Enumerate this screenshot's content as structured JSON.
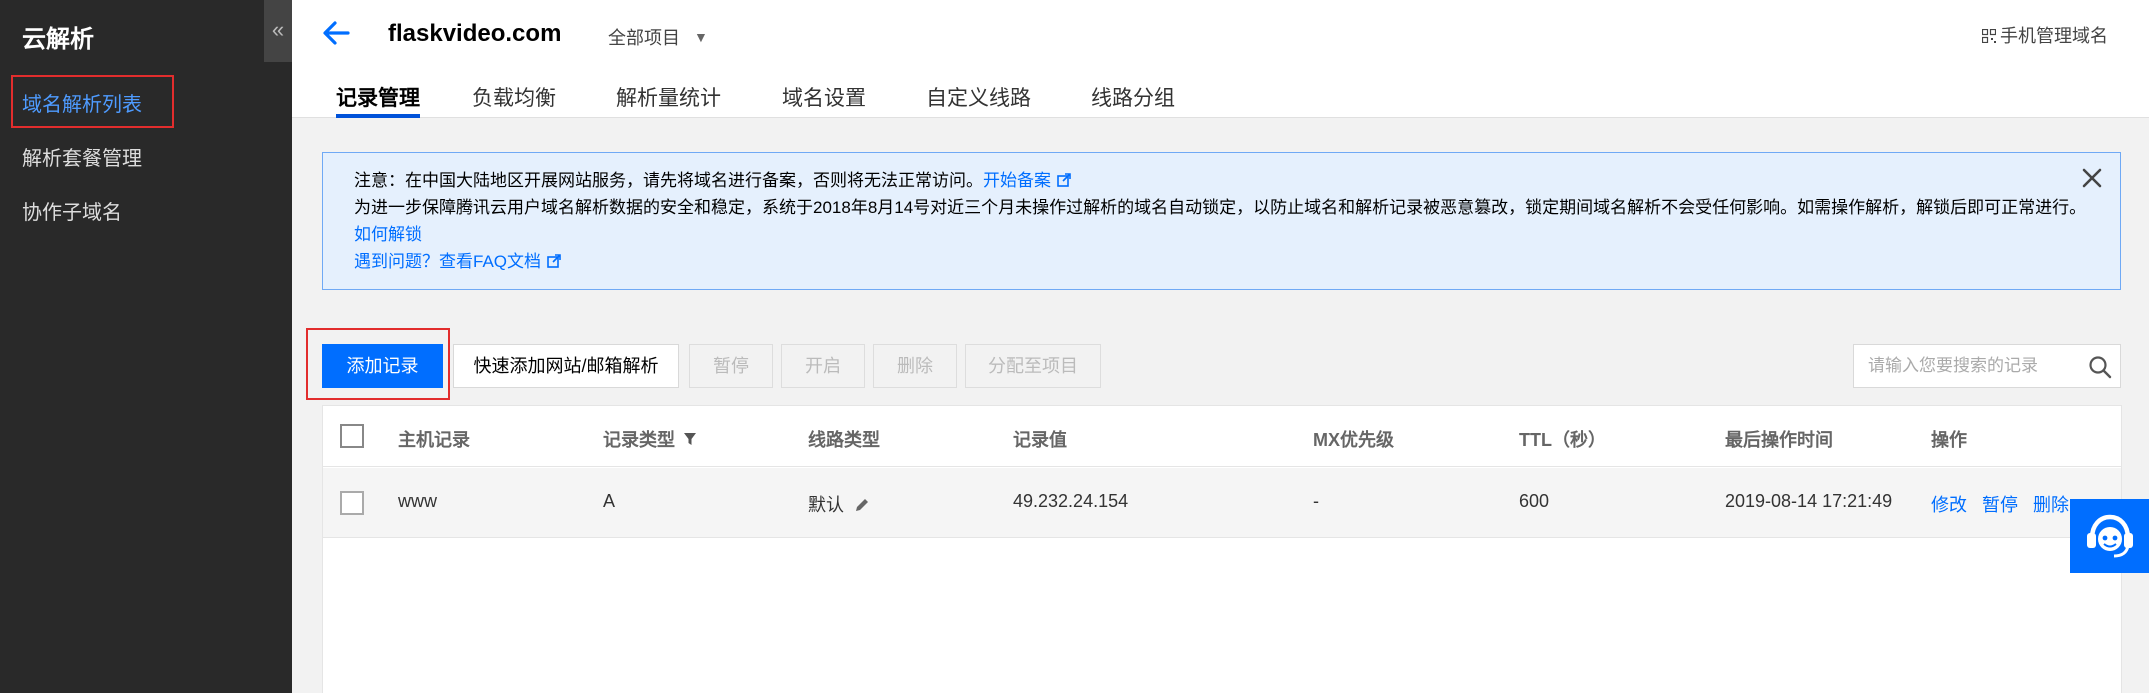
{
  "sidebar": {
    "brand": "云解析",
    "collapse_glyph": "«",
    "items": [
      {
        "label": "域名解析列表",
        "active": true
      },
      {
        "label": "解析套餐管理",
        "active": false
      },
      {
        "label": "协作子域名",
        "active": false
      }
    ]
  },
  "header": {
    "domain": "flaskvideo.com",
    "project": "全部项目",
    "mobile_manage": "手机管理域名",
    "tabs": [
      {
        "label": "记录管理",
        "active": true
      },
      {
        "label": "负载均衡"
      },
      {
        "label": "解析量统计"
      },
      {
        "label": "域名设置"
      },
      {
        "label": "自定义线路"
      },
      {
        "label": "线路分组"
      }
    ]
  },
  "notice": {
    "line1_text": "注意：在中国大陆地区开展网站服务，请先将域名进行备案，否则将无法正常访问。",
    "line1_link": "开始备案",
    "line2_text": "为进一步保障腾讯云用户域名解析数据的安全和稳定，系统于2018年8月14号对近三个月未操作过解析的域名自动锁定，以防止域名和解析记录被恶意篡改，锁定期间域名解析不会受任何影响。如需操作解析，解锁后即可正常进行。",
    "line2_link": "如何解锁",
    "line3_link": "遇到问题？查看FAQ文档"
  },
  "toolbar": {
    "add": "添加记录",
    "quick_add": "快速添加网站/邮箱解析",
    "pause": "暂停",
    "enable": "开启",
    "delete": "删除",
    "assign": "分配至项目",
    "search_placeholder": "请输入您要搜索的记录"
  },
  "table": {
    "headers": {
      "host": "主机记录",
      "type": "记录类型",
      "line": "线路类型",
      "value": "记录值",
      "mx": "MX优先级",
      "ttl": "TTL（秒）",
      "updated": "最后操作时间",
      "actions": "操作"
    },
    "rows": [
      {
        "host": "www",
        "type": "A",
        "line": "默认",
        "value": "49.232.24.154",
        "mx": "-",
        "ttl": "600",
        "updated": "2019-08-14 17:21:49",
        "edit": "修改",
        "pause": "暂停",
        "delete": "删除"
      }
    ]
  },
  "colors": {
    "accent": "#006eff",
    "sidebar_bg": "#292929",
    "highlight_outline": "#e22d2d",
    "notice_bg": "#e5f0fd"
  },
  "icons": [
    "back-arrow-icon",
    "chevron-down-icon",
    "qr-code-icon",
    "external-link-icon",
    "close-icon",
    "search-icon",
    "filter-icon",
    "pencil-icon",
    "support-agent-icon"
  ]
}
